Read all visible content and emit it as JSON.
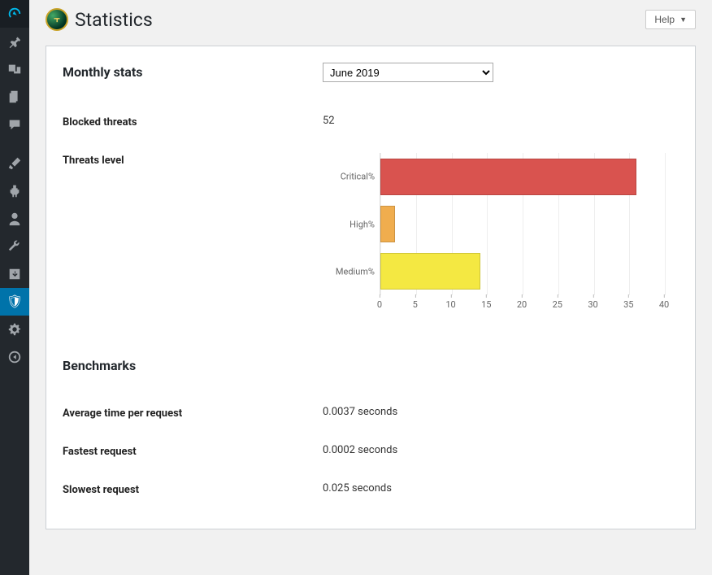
{
  "header": {
    "title": "Statistics",
    "help": "Help"
  },
  "monthly": {
    "heading": "Monthly stats",
    "month_selected": "June 2019",
    "blocked_label": "Blocked threats",
    "blocked_value": "52",
    "threats_label": "Threats level"
  },
  "benchmarks": {
    "heading": "Benchmarks",
    "avg_label": "Average time per request",
    "avg_value": "0.0037 seconds",
    "fast_label": "Fastest request",
    "fast_value": "0.0002 seconds",
    "slow_label": "Slowest request",
    "slow_value": "0.025 seconds"
  },
  "chart_data": {
    "type": "bar",
    "orientation": "horizontal",
    "categories": [
      "Critical%",
      "High%",
      "Medium%"
    ],
    "values": [
      36,
      2,
      14
    ],
    "colors": [
      "#d9534f",
      "#f0ad4e",
      "#f4e842"
    ],
    "xlim": [
      0,
      40
    ],
    "xticks": [
      0,
      5,
      10,
      15,
      20,
      25,
      30,
      35,
      40
    ],
    "title": "",
    "xlabel": "",
    "ylabel": ""
  },
  "icons": {
    "app": "⛨"
  }
}
